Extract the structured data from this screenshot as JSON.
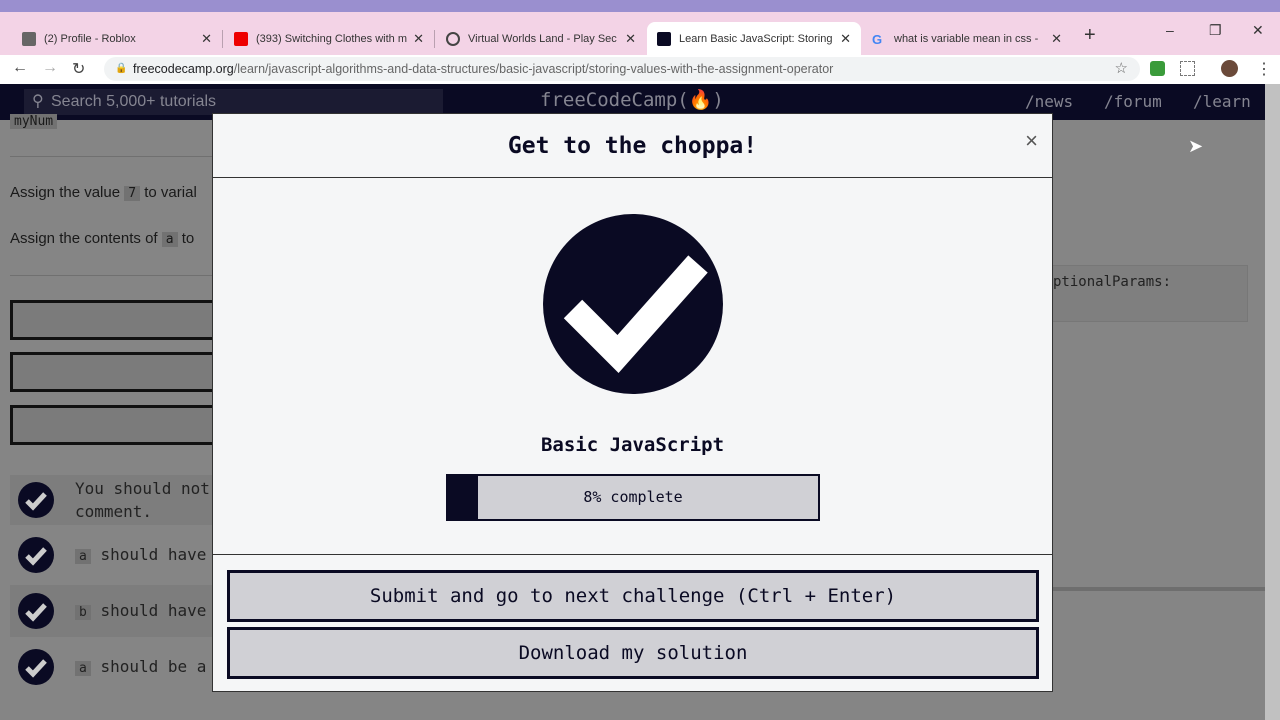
{
  "browser": {
    "tabs": [
      {
        "title": "(2) Profile - Roblox"
      },
      {
        "title": "(393) Switching Clothes with m"
      },
      {
        "title": "Virtual Worlds Land - Play Sec"
      },
      {
        "title": "Learn Basic JavaScript: Storing",
        "active": true
      },
      {
        "title": "what is variable mean in css - "
      }
    ],
    "url_domain": "freecodecamp.org",
    "url_path": "/learn/javascript-algorithms-and-data-structures/basic-javascript/storing-values-with-the-assignment-operator"
  },
  "nav": {
    "search_placeholder": "Search 5,000+ tutorials",
    "logo": "freeCodeCamp(🔥)",
    "links": [
      "/news",
      "/forum",
      "/learn"
    ]
  },
  "background": {
    "top_code": "myNum",
    "p1_pre": "Assign the value",
    "p1_code": "7",
    "p1_post": "to varial",
    "p2_pre": "Assign the contents of",
    "p2_code": "a",
    "p2_post": "to",
    "tests": [
      {
        "text": "You should not",
        "text2": "comment."
      },
      {
        "code": "a",
        "text": "should have"
      },
      {
        "code": "b",
        "text": "should have"
      },
      {
        "code": "a",
        "text": "should be a"
      }
    ],
    "editor_snippet": "ptionalParams:"
  },
  "modal": {
    "title": "Get to the choppa!",
    "close": "×",
    "certification": "Basic JavaScript",
    "progress_percent": 8,
    "progress_label": "8% complete",
    "submit_button": "Submit and go to next challenge (Ctrl + Enter)",
    "download_button": "Download my solution"
  },
  "colors": {
    "primary": "#0a0a23",
    "button_bg": "#d0d0d5",
    "tabstrip": "#f3d3e6"
  }
}
